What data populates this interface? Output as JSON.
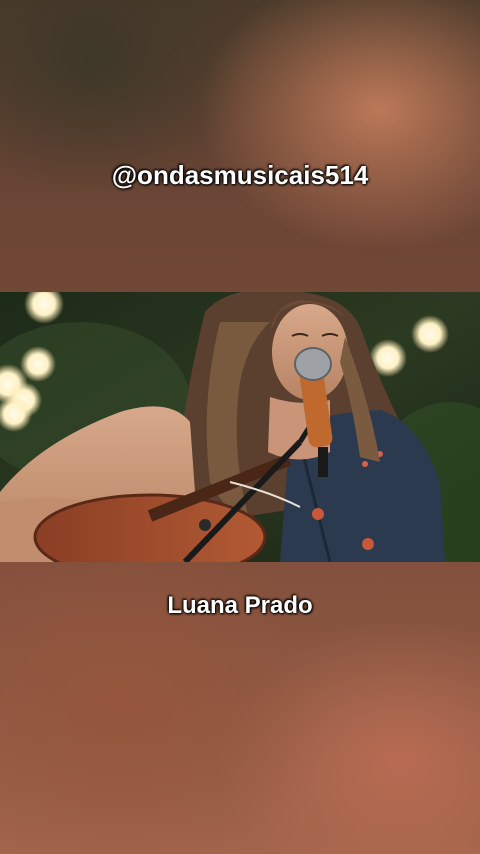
{
  "overlay": {
    "handle": "@ondasmusicais514",
    "artist": "Luana Prado"
  },
  "colors": {
    "background_top": "#4a3a2a",
    "background_bottom": "#a3654c",
    "caption_text": "#ffffff"
  }
}
